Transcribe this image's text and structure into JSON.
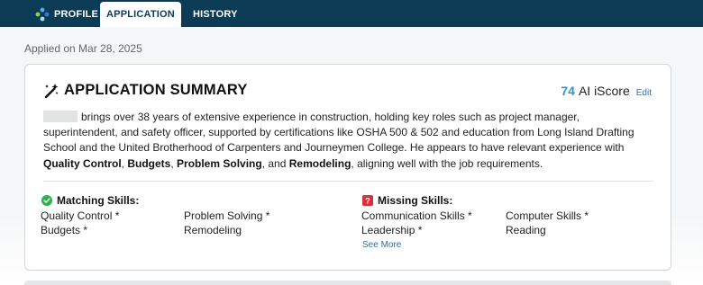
{
  "nav": {
    "tabs": [
      {
        "label": "PROFILE"
      },
      {
        "label": "APPLICATION"
      },
      {
        "label": "HISTORY"
      }
    ],
    "active_tab": "APPLICATION"
  },
  "applied_on": "Applied on Mar 28, 2025",
  "card": {
    "title": "APPLICATION SUMMARY",
    "score_value": "74",
    "score_label": "AI iScore",
    "edit_label": "Edit",
    "summary": {
      "p1": "brings over 38 years of extensive experience in construction, holding key roles such as project manager, superintendent, and safety officer, supported by certifications like OSHA 500 & 502 and education from Long Island Drafting School and the United Brotherhood of Carpenters and Journeymen College. He appears to have relevant experience with ",
      "b1": "Quality Control",
      "s1": ", ",
      "b2": "Budgets",
      "s2": ", ",
      "b3": "Problem Solving",
      "s3": ", and ",
      "b4": "Remodeling",
      "s4": ", aligning well with the job requirements."
    },
    "matching": {
      "label": "Matching Skills:",
      "items": [
        "Quality Control *",
        "Problem Solving *",
        "Budgets *",
        "Remodeling"
      ]
    },
    "missing": {
      "label": "Missing Skills:",
      "items": [
        "Communication Skills *",
        "Computer Skills *",
        "Leadership *",
        "Reading"
      ],
      "see_more": "See More"
    }
  },
  "colors": {
    "nav_bg": "#0c3b56",
    "score": "#2f96c8",
    "link": "#2a6fb0",
    "match_icon": "#2bb24c",
    "missing_icon": "#d4323c"
  }
}
